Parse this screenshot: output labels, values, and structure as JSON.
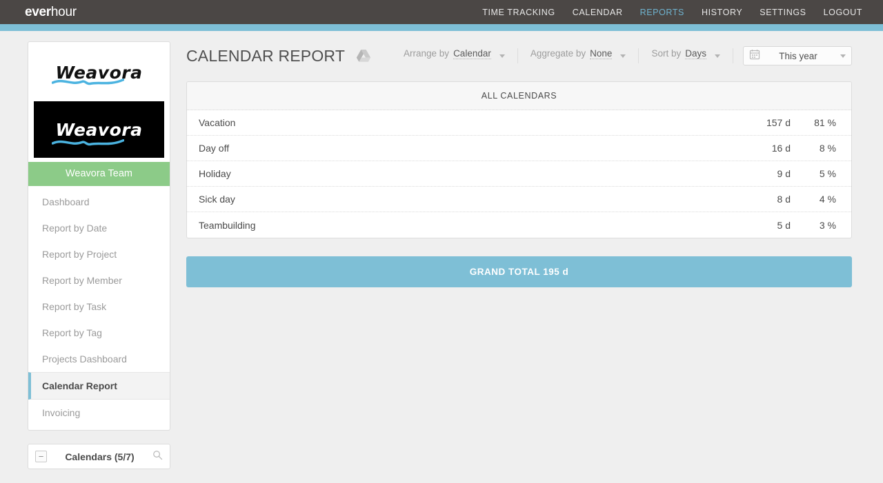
{
  "brand": {
    "bold_part": "ever",
    "light_part": "hour"
  },
  "nav": {
    "items": [
      {
        "label": "TIME TRACKING",
        "active": false
      },
      {
        "label": "CALENDAR",
        "active": false
      },
      {
        "label": "REPORTS",
        "active": true
      },
      {
        "label": "HISTORY",
        "active": false
      },
      {
        "label": "SETTINGS",
        "active": false
      },
      {
        "label": "LOGOUT",
        "active": false
      }
    ],
    "active_color": "#6fb3cf"
  },
  "sidebar": {
    "logo_text": "Weavora",
    "team_label": "Weavora Team",
    "team_color": "#8ccb88",
    "items": [
      {
        "label": "Dashboard",
        "active": false
      },
      {
        "label": "Report by Date",
        "active": false
      },
      {
        "label": "Report by Project",
        "active": false
      },
      {
        "label": "Report by Member",
        "active": false
      },
      {
        "label": "Report by Task",
        "active": false
      },
      {
        "label": "Report by Tag",
        "active": false
      },
      {
        "label": "Projects Dashboard",
        "active": false
      },
      {
        "label": "Calendar Report",
        "active": true
      },
      {
        "label": "Invoicing",
        "active": false
      }
    ],
    "calendars_panel": {
      "title": "Calendars (5/7)",
      "collapse_glyph": "−",
      "search_glyph": "⚲"
    }
  },
  "header": {
    "title": "CALENDAR REPORT",
    "drive_icon": "google-drive-icon"
  },
  "toolbar": {
    "arrange": {
      "label": "Arrange by",
      "value": "Calendar"
    },
    "aggregate": {
      "label": "Aggregate by",
      "value": "None"
    },
    "sort": {
      "label": "Sort by",
      "value": "Days"
    },
    "date_range": {
      "value": "This year",
      "icon": "calendar-icon"
    }
  },
  "table": {
    "header": "ALL CALENDARS",
    "rows": [
      {
        "name": "Vacation",
        "days": "157 d",
        "pct": "81 %"
      },
      {
        "name": "Day off",
        "days": "16 d",
        "pct": "8 %"
      },
      {
        "name": "Holiday",
        "days": "9 d",
        "pct": "5 %"
      },
      {
        "name": "Sick day",
        "days": "8 d",
        "pct": "4 %"
      },
      {
        "name": "Teambuilding",
        "days": "5 d",
        "pct": "3 %"
      }
    ],
    "grand_total": "GRAND TOTAL 195 d",
    "grand_total_color": "#7ebfd6"
  }
}
